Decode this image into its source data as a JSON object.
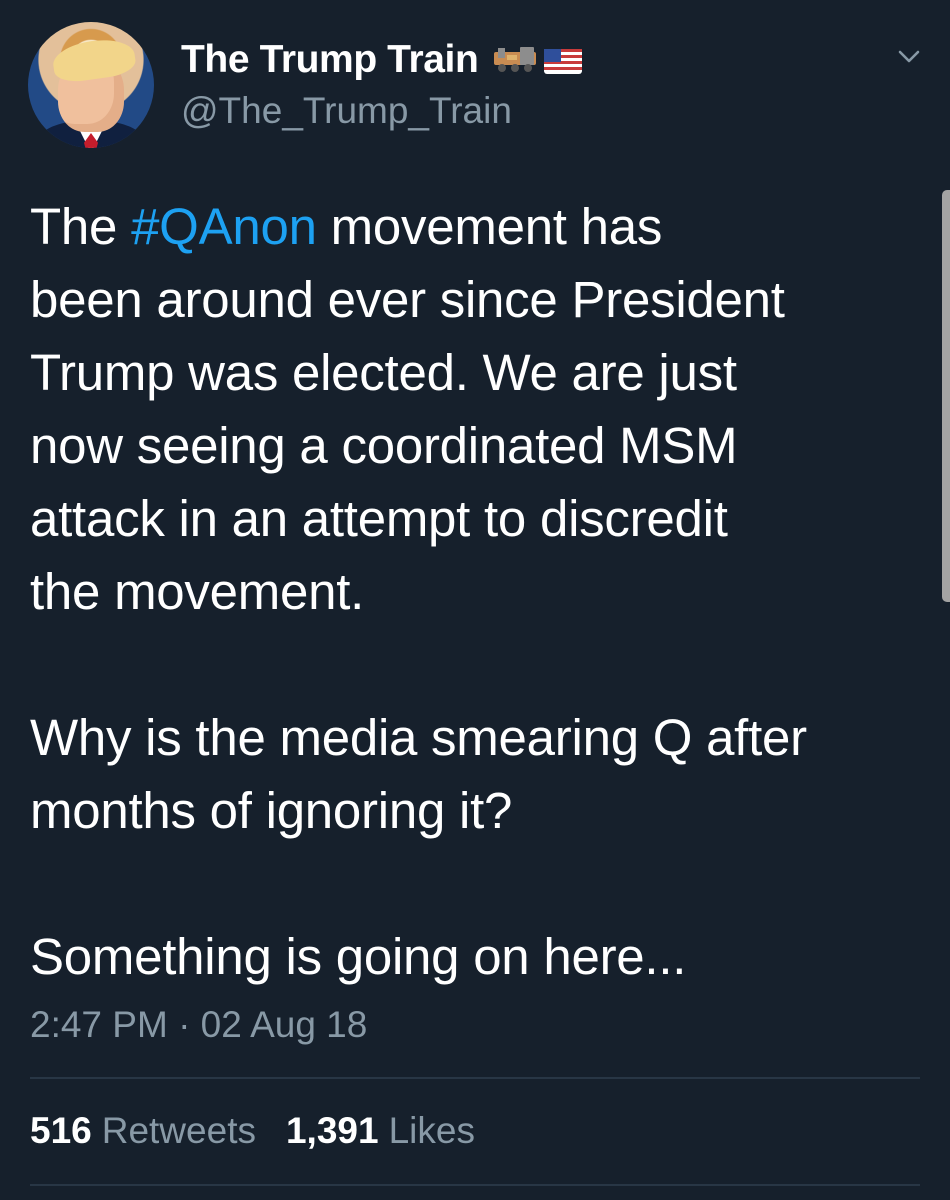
{
  "theme": {
    "background": "#16202c",
    "text": "#ffffff",
    "muted": "#8899a6",
    "link": "#1da1f2",
    "divider": "#283645",
    "scrollbar": "#a3a3a3"
  },
  "user": {
    "display_name": "The Trump Train",
    "handle": "@The_Trump_Train",
    "name_icons": [
      "train-emoji-icon",
      "us-flag-emoji-icon"
    ],
    "avatar_icon": "profile-avatar"
  },
  "tweet": {
    "text_lines": [
      {
        "prefix": "The ",
        "hashtag": "#QAnon",
        "suffix": " movement has"
      },
      {
        "text": "been around ever since President"
      },
      {
        "text": "Trump was elected. We are just"
      },
      {
        "text": "now seeing a coordinated MSM"
      },
      {
        "text": "attack in an attempt to discredit"
      },
      {
        "text": "the movement."
      },
      {
        "text": ""
      },
      {
        "text": "Why is the media smearing Q after"
      },
      {
        "text": "months of ignoring it?"
      },
      {
        "text": ""
      },
      {
        "text": "Something is going on here..."
      }
    ],
    "timestamp": "2:47 PM · 02 Aug 18"
  },
  "stats": {
    "retweets_value": "516",
    "retweets_label": "Retweets",
    "likes_value": "1,391",
    "likes_label": "Likes"
  },
  "icons": {
    "caret": "chevron-down-icon"
  }
}
